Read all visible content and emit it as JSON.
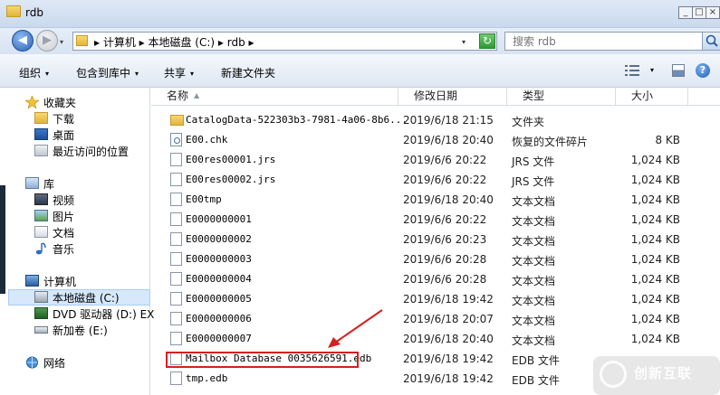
{
  "window": {
    "title": "rdb",
    "min": "_",
    "max": "□",
    "close": "×"
  },
  "address": {
    "breadcrumb": "▸ 计算机 ▸ 本地磁盘 (C:) ▸ rdb ▸",
    "nav_drop": "▾",
    "addr_drop": "▾",
    "refresh": "↻"
  },
  "search": {
    "placeholder": "搜索 rdb"
  },
  "toolbar": {
    "organize": "组织",
    "include": "包含到库中",
    "share": "共享",
    "new_folder": "新建文件夹",
    "arrow": "▾",
    "help": "?"
  },
  "nav": {
    "favorites": "收藏夹",
    "downloads": "下载",
    "desktop": "桌面",
    "recent": "最近访问的位置",
    "libraries": "库",
    "videos": "视频",
    "pictures": "图片",
    "documents": "文档",
    "music": "音乐",
    "computer": "计算机",
    "local_disk": "本地磁盘 (C:)",
    "dvd": "DVD 驱动器 (D:) EX",
    "new_volume": "新加卷 (E:)",
    "network": "网络"
  },
  "columns": {
    "name": "名称",
    "date": "修改日期",
    "type": "类型",
    "size": "大小",
    "sort": "▲"
  },
  "files": [
    {
      "name": "CatalogData-522303b3-7981-4a06-8b6...",
      "date": "2019/6/18 21:15",
      "type": "文件夹",
      "size": "",
      "kind": "folder"
    },
    {
      "name": "E00.chk",
      "date": "2019/6/18 20:40",
      "type": "恢复的文件碎片",
      "size": "8 KB",
      "kind": "chk"
    },
    {
      "name": "E00res00001.jrs",
      "date": "2019/6/6 20:22",
      "type": "JRS 文件",
      "size": "1,024 KB",
      "kind": "file"
    },
    {
      "name": "E00res00002.jrs",
      "date": "2019/6/6 20:22",
      "type": "JRS 文件",
      "size": "1,024 KB",
      "kind": "file"
    },
    {
      "name": "E00tmp",
      "date": "2019/6/18 20:40",
      "type": "文本文档",
      "size": "1,024 KB",
      "kind": "file"
    },
    {
      "name": "E0000000001",
      "date": "2019/6/6 20:22",
      "type": "文本文档",
      "size": "1,024 KB",
      "kind": "file"
    },
    {
      "name": "E0000000002",
      "date": "2019/6/6 20:23",
      "type": "文本文档",
      "size": "1,024 KB",
      "kind": "file"
    },
    {
      "name": "E0000000003",
      "date": "2019/6/6 20:28",
      "type": "文本文档",
      "size": "1,024 KB",
      "kind": "file"
    },
    {
      "name": "E0000000004",
      "date": "2019/6/6 20:28",
      "type": "文本文档",
      "size": "1,024 KB",
      "kind": "file"
    },
    {
      "name": "E0000000005",
      "date": "2019/6/18 19:42",
      "type": "文本文档",
      "size": "1,024 KB",
      "kind": "file"
    },
    {
      "name": "E0000000006",
      "date": "2019/6/18 20:07",
      "type": "文本文档",
      "size": "1,024 KB",
      "kind": "file"
    },
    {
      "name": "E0000000007",
      "date": "2019/6/18 20:40",
      "type": "文本文档",
      "size": "1,024 KB",
      "kind": "file"
    },
    {
      "name": "Mailbox Database 0035626591.edb",
      "date": "2019/6/18 19:42",
      "type": "EDB 文件",
      "size": "",
      "kind": "file"
    },
    {
      "name": "tmp.edb",
      "date": "2019/6/18 19:42",
      "type": "EDB 文件",
      "size": "",
      "kind": "file"
    }
  ],
  "watermark": {
    "text": "创新互联"
  }
}
